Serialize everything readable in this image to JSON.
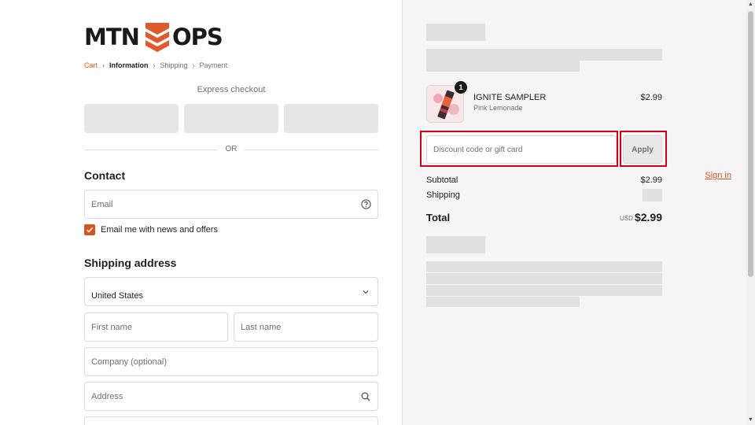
{
  "brand": {
    "logo_text": "MTN OPS",
    "logo_accent": "#e05a2b"
  },
  "breadcrumb": {
    "items": [
      "Cart",
      "Information",
      "Shipping",
      "Payment"
    ]
  },
  "express": {
    "title": "Express checkout",
    "divider": "OR"
  },
  "contact": {
    "title": "Contact",
    "signin_label": "Sign in",
    "email_placeholder": "Email",
    "newsletter_label": "Email me with news and offers",
    "newsletter_checked": true
  },
  "shipping": {
    "title": "Shipping address",
    "country_value": "United States",
    "first_name_placeholder": "First name",
    "last_name_placeholder": "Last name",
    "company_placeholder": "Company (optional)",
    "address_placeholder": "Address"
  },
  "order": {
    "item": {
      "name": "IGNITE SAMPLER",
      "variant": "Pink Lemonade",
      "price": "$2.99",
      "quantity": "1"
    },
    "discount_placeholder": "Discount code or gift card",
    "apply_label": "Apply",
    "subtotal_label": "Subtotal",
    "subtotal_value": "$2.99",
    "shipping_label": "Shipping",
    "total_label": "Total",
    "currency": "USD",
    "total_value": "$2.99"
  },
  "colors": {
    "accent": "#d9531e",
    "highlight": "#d0021b"
  }
}
